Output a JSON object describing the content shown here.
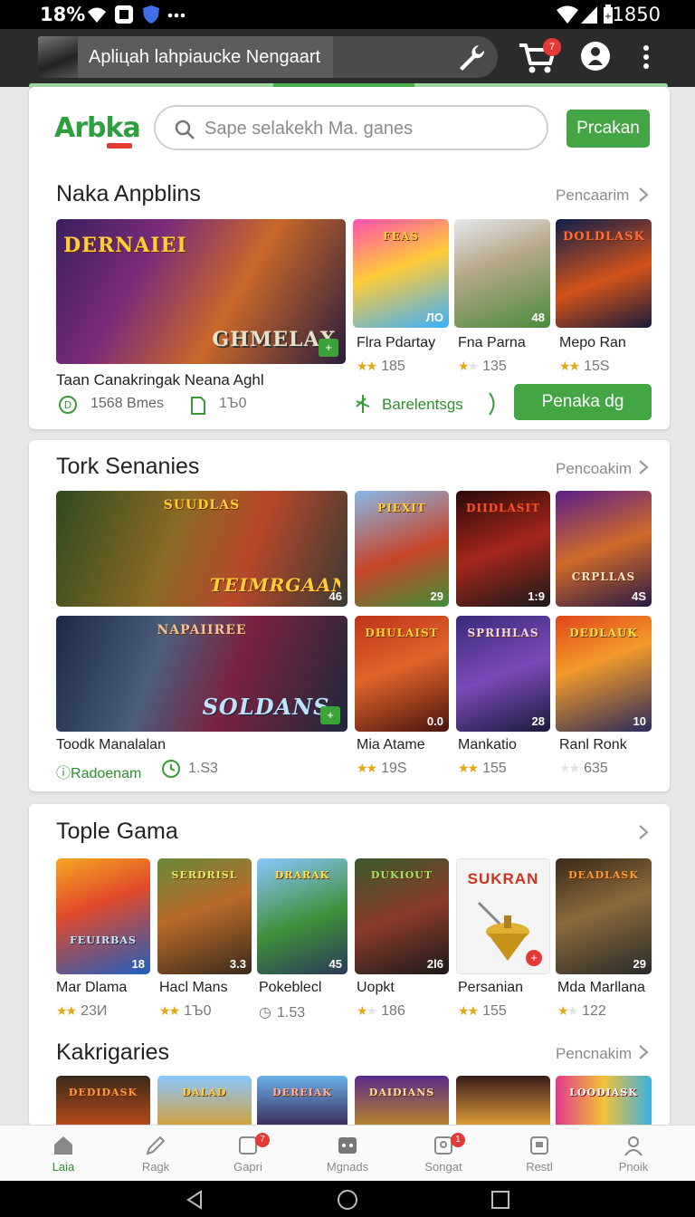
{
  "status": {
    "time": "18%",
    "clock": "1850"
  },
  "appbar": {
    "title": "Apliцah lahpiaucke Nengaart",
    "cart_count": "7"
  },
  "header": {
    "logo": "Arbka",
    "search_placeholder": "Sape selakekh Ma. ganes",
    "search_button": "Prcakan"
  },
  "section1": {
    "title": "Naka Anpblins",
    "more": "Pencaarim",
    "hero": {
      "art_title": "DERNAIEI",
      "art_subtitle": "GHMELAX",
      "name": "Taan Canakringak Neana Aghl",
      "stat1": "1568 Bmes",
      "stat2": "1Ъ0",
      "tag": "Barelentsgs",
      "button": "Penaka dg"
    },
    "games": [
      {
        "name": "Flra Pdartay",
        "rating": "185",
        "badge": "ЛО",
        "art": "FEAS"
      },
      {
        "name": "Fna Parna",
        "rating": "135",
        "badge": "48",
        "art": ""
      },
      {
        "name": "Mepo Ran",
        "rating": "15Ѕ",
        "badge": "",
        "art": "DOLDLASK"
      }
    ]
  },
  "section2": {
    "title": "Tork Senanies",
    "more": "Pencoakim",
    "hero1": {
      "art_title": "TEIMRGAAN",
      "art_top": "SUUDLAS",
      "badge": "46"
    },
    "hero2": {
      "art_title": "SOLDANS",
      "art_top": "NAPAIIREE",
      "name": "Toodk Manalalan",
      "tag": "Radoenam",
      "stat": "1.Ѕ3"
    },
    "games_top": [
      {
        "badge": "29",
        "art": "PIEXIT"
      },
      {
        "badge": "1:9",
        "art": "DIIDLASIT"
      },
      {
        "badge": "4Ѕ",
        "art": "CRPLLAS"
      }
    ],
    "games_bottom": [
      {
        "name": "Mia Atame",
        "rating": "19Ѕ",
        "badge": "0.0",
        "art": "DHULAIST"
      },
      {
        "name": "Mankatio",
        "rating": "155",
        "badge": "28",
        "art": "SPRIHLAS"
      },
      {
        "name": "Ranl Ronk",
        "rating": "635",
        "badge": "10",
        "art": "DEDLAUK"
      }
    ]
  },
  "section3": {
    "title": "Tople Gama",
    "games": [
      {
        "name": "Mar Dlama",
        "rating": "23И",
        "badge": "18",
        "art": "FEUIRBAS"
      },
      {
        "name": "Hacl Mans",
        "rating": "1Ъ0",
        "badge": "3.3",
        "art": "SERDRISL"
      },
      {
        "name": "Pokeblecl",
        "rating": "1.53",
        "badge": "45",
        "art": "DRARAK"
      },
      {
        "name": "Uopkt",
        "rating": "186",
        "badge": "2l6",
        "art": "DUKIOUT"
      },
      {
        "name": "Persanian",
        "rating": "155",
        "badge": "",
        "art": "SUKRAN"
      },
      {
        "name": "Mda Marllana",
        "rating": "122",
        "badge": "29",
        "art": "DEADLASK"
      }
    ]
  },
  "section4": {
    "title": "Kakrigaries",
    "more": "Pencnakim",
    "arts": [
      "DEDIDASK",
      "DALAD",
      "DEREIAK",
      "DAIDIANS",
      "",
      "LOODIASK"
    ]
  },
  "nav": [
    {
      "label": "Laia",
      "icon": "home-icon",
      "badge": ""
    },
    {
      "label": "Ragk",
      "icon": "pencil-icon",
      "badge": ""
    },
    {
      "label": "Gapri",
      "icon": "square-icon",
      "badge": "7"
    },
    {
      "label": "Mgnads",
      "icon": "gamepad-icon",
      "badge": ""
    },
    {
      "label": "Songat",
      "icon": "map-icon",
      "badge": "1"
    },
    {
      "label": "Restl",
      "icon": "box-icon",
      "badge": ""
    },
    {
      "label": "Pnoik",
      "icon": "person-icon",
      "badge": ""
    }
  ],
  "colors": {
    "accent": "#43a543",
    "badge": "#e53935",
    "star": "#e3a81a"
  }
}
